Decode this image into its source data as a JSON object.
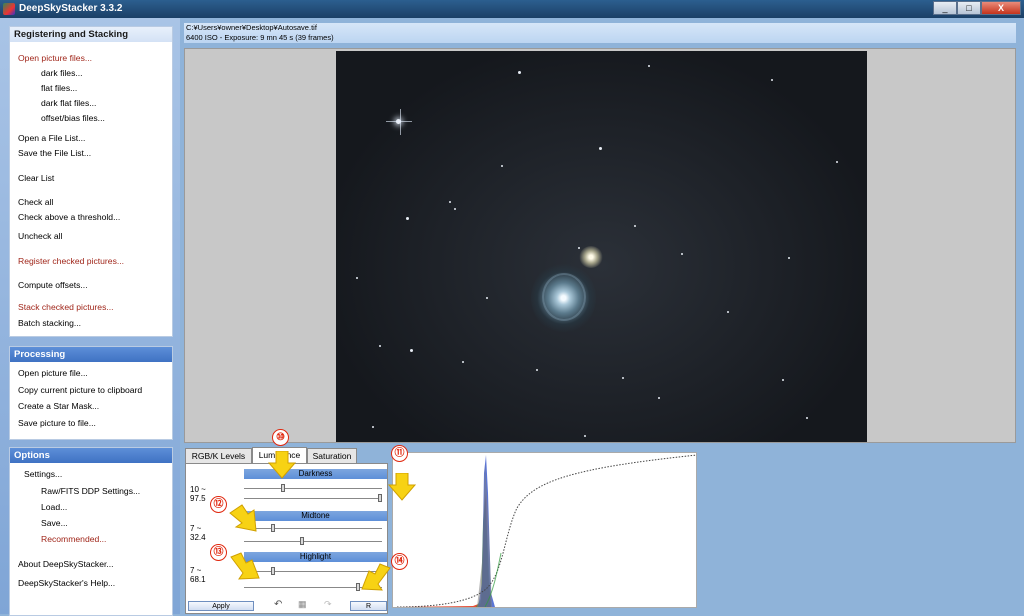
{
  "window": {
    "title": "DeepSkyStacker 3.3.2",
    "minimize": "_",
    "maximize": "□",
    "close": "X"
  },
  "sidebar": {
    "registering": {
      "header": "Registering and Stacking",
      "items": [
        {
          "label": "Open picture files...",
          "red": true
        },
        {
          "label": "dark files...",
          "indent": true
        },
        {
          "label": "flat files...",
          "indent": true
        },
        {
          "label": "dark flat files...",
          "indent": true
        },
        {
          "label": "offset/bias files...",
          "indent": true
        },
        {
          "label": "Open a File List..."
        },
        {
          "label": "Save the File List..."
        },
        {
          "label": "Clear List"
        },
        {
          "label": "Check all"
        },
        {
          "label": "Check above a threshold..."
        },
        {
          "label": "Uncheck all"
        },
        {
          "label": "Register checked pictures...",
          "red": true
        },
        {
          "label": "Compute offsets..."
        },
        {
          "label": "Stack checked pictures...",
          "red": true
        },
        {
          "label": "Batch stacking..."
        }
      ]
    },
    "processing": {
      "header": "Processing",
      "items": [
        {
          "label": "Open picture file..."
        },
        {
          "label": "Copy current picture to clipboard"
        },
        {
          "label": "Create a Star Mask..."
        },
        {
          "label": "Save picture to file..."
        }
      ]
    },
    "options": {
      "header": "Options",
      "items": [
        {
          "label": "Settings..."
        },
        {
          "label": "Raw/FITS DDP Settings...",
          "indent": true
        },
        {
          "label": "Load...",
          "indent": true
        },
        {
          "label": "Save...",
          "indent": true
        },
        {
          "label": "Recommended...",
          "red": true,
          "indent": true
        },
        {
          "label": "About DeepSkyStacker..."
        },
        {
          "label": "DeepSkyStacker's Help..."
        }
      ]
    }
  },
  "file": {
    "path": "C:¥Users¥owner¥Desktop¥Autosave.tif",
    "info": "6400 ISO - Exposure: 9 mn 45 s (39 frames)"
  },
  "adjust": {
    "tabs": [
      "RGB/K Levels",
      "Luminance",
      "Saturation"
    ],
    "active_tab": "Luminance",
    "sections": [
      {
        "name": "Darkness",
        "value1": "10 ~",
        "value2": "97.5",
        "level": 0.27
      },
      {
        "name": "Midtone",
        "value1": "7 ~",
        "value2": "32.4",
        "level": 0.2
      },
      {
        "name": "Highlight",
        "value1": "7 ~",
        "value2": "68.1",
        "level": 0.2
      }
    ],
    "apply_label": "Apply",
    "reset_label": "R"
  },
  "callouts": [
    "⑩",
    "⑪",
    "⑫",
    "⑬",
    "⑭"
  ],
  "colors": {
    "arrow": "#f7d214",
    "callout": "#e0280f",
    "histo_red": "#e23a20",
    "histo_green": "#2f9b3c",
    "histo_blue": "#2447c8"
  }
}
